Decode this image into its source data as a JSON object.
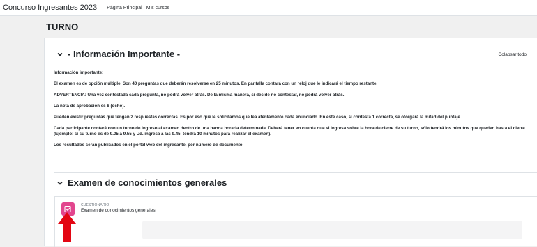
{
  "navbar": {
    "site_name": "Concurso Ingresantes 2023",
    "links": [
      "Página Principal",
      "Mis cursos"
    ]
  },
  "page_title": "TURNO",
  "collapse_all": "Colapsar todo",
  "sections": [
    {
      "title": "- Información Importante -"
    },
    {
      "title": "Examen de conocimientos generales"
    }
  ],
  "info_paragraphs": [
    "Información importante:",
    "El examen es de opción múltiple. Son 40 preguntas que deberán resolverse en 25 minutos. En pantalla contará con un reloj que le indicará el tiempo restante.",
    "ADVERTENCIA: Una vez contestada cada pregunta, no podrá volver atrás. De la misma manera, si decide no contestar, no podrá volver atrás.",
    "La nota de aprobación es 8 (ocho).",
    "Pueden existir preguntas que tengan 2 respuestas correctas. Es por eso que le solicitamos que lea atentamente cada enunciado. En este caso, si contesta 1 correcta, se otorgará la mitad del puntaje.",
    "Cada participante contará con un turno de ingreso al examen dentro de una banda horaria determinada. Deberá tener en cuenta que si ingresa sobre la hora de cierre de su turno, sólo tendrá los minutos que queden hasta el cierre. (Ejemplo: si su turno es de 9.05 a 9.55 y Ud. ingresa a las 9.45, tendrá 10 minutos para realizar el examen).",
    "Los resultados serán publicados en el portal web del ingresante, por número de documento"
  ],
  "activity": {
    "type_label": "CUESTIONARIO",
    "name": "Examen de conocimientos generales"
  },
  "colors": {
    "quiz_icon": "#e2468e",
    "arrow": "#e30613"
  }
}
